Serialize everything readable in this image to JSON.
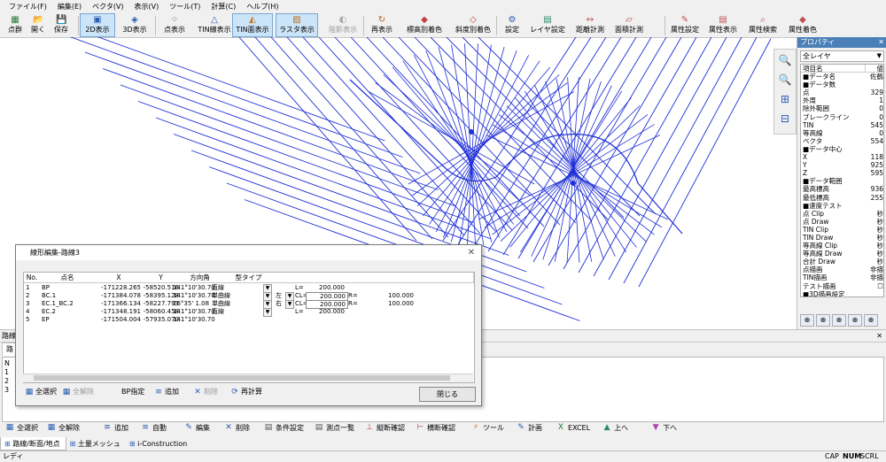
{
  "menu": [
    "ファイル(F)",
    "編集(E)",
    "ベクタ(V)",
    "表示(V)",
    "ツール(T)",
    "計算(C)",
    "ヘルプ(H)"
  ],
  "toolbar": [
    {
      "label": "点群",
      "icon": "point-cloud-icon"
    },
    {
      "label": "開く",
      "icon": "open-icon"
    },
    {
      "label": "保存",
      "icon": "save-icon"
    },
    {
      "label": "2D表示",
      "icon": "2d-view-icon",
      "active": true
    },
    {
      "label": "3D表示",
      "icon": "3d-view-icon"
    },
    {
      "label": "点表示",
      "icon": "point-display-icon"
    },
    {
      "label": "TIN線表示",
      "icon": "tin-line-icon"
    },
    {
      "label": "TIN面表示",
      "icon": "tin-surface-icon",
      "active": true
    },
    {
      "label": "ラスタ表示",
      "icon": "raster-icon",
      "active": true
    },
    {
      "label": "陰影表示",
      "icon": "shade-icon",
      "disabled": true
    },
    {
      "label": "再表示",
      "icon": "redraw-icon"
    },
    {
      "label": "標高別着色",
      "icon": "elevation-color-icon"
    },
    {
      "label": "斜度別着色",
      "icon": "slope-color-icon"
    },
    {
      "label": "設定",
      "icon": "settings-icon"
    },
    {
      "label": "レイヤ設定",
      "icon": "layer-settings-icon"
    },
    {
      "label": "距離計測",
      "icon": "distance-measure-icon"
    },
    {
      "label": "面積計測",
      "icon": "area-measure-icon"
    },
    {
      "label": "属性設定",
      "icon": "attribute-settings-icon"
    },
    {
      "label": "属性表示",
      "icon": "attribute-display-icon"
    },
    {
      "label": "属性検索",
      "icon": "attribute-search-icon"
    },
    {
      "label": "属性着色",
      "icon": "attribute-color-icon"
    }
  ],
  "property": {
    "title": "プロパティ",
    "layer_select": "全レイヤ",
    "header_key": "項目名",
    "header_val": "値",
    "rows": [
      {
        "k": "■データ名",
        "v": "佐鶴"
      },
      {
        "k": "■データ数",
        "v": ""
      },
      {
        "k": "点",
        "v": "329"
      },
      {
        "k": "外周",
        "v": "1"
      },
      {
        "k": "除外範囲",
        "v": "0"
      },
      {
        "k": "ブレークライン",
        "v": "0"
      },
      {
        "k": "TIN",
        "v": "545"
      },
      {
        "k": "等高線",
        "v": "0"
      },
      {
        "k": "ベクタ",
        "v": "554"
      },
      {
        "k": "■データ中心",
        "v": ""
      },
      {
        "k": "X",
        "v": "118"
      },
      {
        "k": "Y",
        "v": "925"
      },
      {
        "k": "Z",
        "v": "595"
      },
      {
        "k": "■データ範囲",
        "v": ""
      },
      {
        "k": "最高標高",
        "v": "936"
      },
      {
        "k": "最低標高",
        "v": "255"
      },
      {
        "k": "■速度テスト",
        "v": ""
      },
      {
        "k": "点 Clip",
        "v": "秒"
      },
      {
        "k": "点 Draw",
        "v": "秒"
      },
      {
        "k": "TIN Clip",
        "v": "秒"
      },
      {
        "k": "TIN Draw",
        "v": "秒"
      },
      {
        "k": "等高線 Clip",
        "v": "秒"
      },
      {
        "k": "等高線 Draw",
        "v": "秒"
      },
      {
        "k": "合計 Draw",
        "v": "秒"
      },
      {
        "k": "点描画",
        "v": "非描"
      },
      {
        "k": "TIN描画",
        "v": "非描"
      },
      {
        "k": "テスト描画",
        "v": "☐"
      },
      {
        "k": "■3D描画設定",
        "v": ""
      }
    ]
  },
  "dialog": {
    "title": "線形編集-路線3",
    "columns": [
      "No.",
      "点名",
      "X",
      "Y",
      "方向角",
      "型タイプ"
    ],
    "rows": [
      {
        "no": "1",
        "name": "BP",
        "x": "-171228.265",
        "y": "-58520.516",
        "dir": "141°10'30.70",
        "type": "直線",
        "side": "",
        "p1": "L=",
        "p1v": "200.000",
        "p2": "",
        "p2v": ""
      },
      {
        "no": "2",
        "name": "BC.1",
        "x": "-171384.078",
        "y": "-58395.128",
        "dir": "141°10'30.70",
        "type": "単曲線",
        "side": "左",
        "p1": "CL=",
        "p1v": "200.000",
        "p2": "R=",
        "p2v": "100.000"
      },
      {
        "no": "3",
        "name": "EC.1_BC.2",
        "x": "-171366.134",
        "y": "-58227.793",
        "dir": "26°35' 1.08",
        "type": "単曲線",
        "side": "右",
        "p1": "CL=",
        "p1v": "200.000",
        "p2": "R=",
        "p2v": "100.000"
      },
      {
        "no": "4",
        "name": "EC.2",
        "x": "-171348.191",
        "y": "-58060.458",
        "dir": "141°10'30.70",
        "type": "直線",
        "side": "",
        "p1": "L=",
        "p1v": "200.000",
        "p2": "",
        "p2v": ""
      },
      {
        "no": "5",
        "name": "EP",
        "x": "-171504.004",
        "y": "-57935.070",
        "dir": "141°10'30.70",
        "type": "",
        "side": "",
        "p1": "",
        "p1v": "",
        "p2": "",
        "p2v": ""
      }
    ],
    "buttons": {
      "select_all": "全選択",
      "deselect_all": "全解除",
      "bp": "BP指定",
      "add": "追加",
      "delete": "削除",
      "recalc": "再計算",
      "close": "閉じる"
    }
  },
  "bottom": {
    "title": "路線",
    "tab": "路",
    "row_nums": [
      "N",
      "1",
      "2",
      "3"
    ],
    "buttons": [
      "全選択",
      "全解除",
      "追加",
      "自動",
      "編集",
      "削除",
      "条件設定",
      "測点一覧",
      "縦断確認",
      "横断確認",
      "ツール",
      "計画",
      "EXCEL",
      "上へ",
      "下へ"
    ],
    "tabs": [
      "路線/断面/地点",
      "土量メッシュ",
      "i-Construction"
    ]
  },
  "status": {
    "text": "レディ",
    "cap": "CAP",
    "num": "NUM",
    "scrl": "SCRL"
  }
}
